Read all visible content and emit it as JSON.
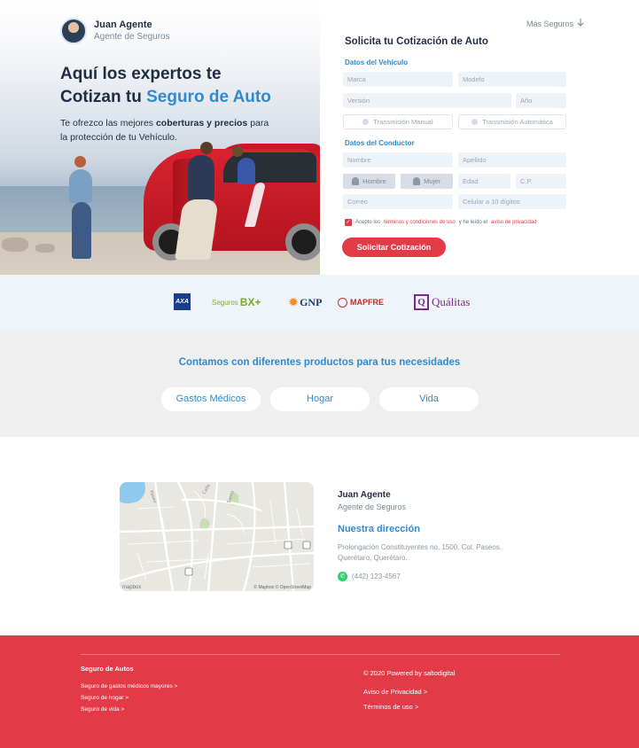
{
  "agent": {
    "name": "Juan Agente",
    "role": "Agente de Seguros"
  },
  "hero": {
    "title_line1": "Aquí los expertos te",
    "title_line2_prefix": "Cotizan tu",
    "title_line2_accent": "Seguro de Auto",
    "sub_prefix": "Te ofrezco las mejores",
    "sub_bold": "coberturas y precios",
    "sub_suffix": "para la protección de tu Vehículo."
  },
  "nav": {
    "more_label": "Más Seguros",
    "more_icon": "arrow-down-icon"
  },
  "form": {
    "title": "Solicita tu Cotización de Auto",
    "vehicle_section": "Datos del Vehículo",
    "marca": "Marca",
    "modelo": "Modelo",
    "version": "Versión",
    "anio": "Año",
    "transmision_manual": "Transmisión Manual",
    "transmision_auto": "Transmisión Automática",
    "driver_section": "Datos del Conductor",
    "nombre": "Nombre",
    "apellido": "Apellido",
    "hombre": "Hombre",
    "mujer": "Mujer",
    "edad": "Edad",
    "cp": "C.P.",
    "correo": "Correo",
    "celular": "Celular a 10 dígitos",
    "terms_prefix": "Acepto los",
    "terms_link": "términos y condiciones de uso",
    "terms_middle": "y he leído el",
    "privacy_link": "aviso de privacidad",
    "terms_checked": true,
    "submit_label": "Solicitar Cotización"
  },
  "insurers": {
    "axa": "AXA",
    "bx_prefix": "Seguros",
    "bx_mark": "BX+",
    "gnp": "GNP",
    "mapfre": "MAPFRE",
    "qualitas_mark": "Q",
    "qualitas": "Quálitas"
  },
  "products": {
    "title": "Contamos con diferentes productos para tus necesidades",
    "items": [
      "Gastos Médicos",
      "Hogar",
      "Vida"
    ]
  },
  "contact": {
    "name": "Juan Agente",
    "role": "Agente de Seguros",
    "heading": "Nuestra dirección",
    "address": "Prolongación Constituyentes no. 1500. Col. Paseos. Querétaro, Querétaro.",
    "phone": "(442) 123-4567",
    "map_logo": "mapbox",
    "map_attribution": "© Mapbox © OpenStreetMap"
  },
  "footer": {
    "heading": "Seguro de Autos",
    "links": [
      "Seguro de gastos médicos mayores >",
      "Seguro de hogar >",
      "Seguro de vida >"
    ],
    "copyright": "© 2020 Powered by saltodigital",
    "privacy": "Aviso de Privacidad >",
    "terms": "Términos de uso >"
  },
  "colors": {
    "accent": "#2f8ad0",
    "brand_red": "#e33a47",
    "text_dark": "#1f2d44"
  }
}
